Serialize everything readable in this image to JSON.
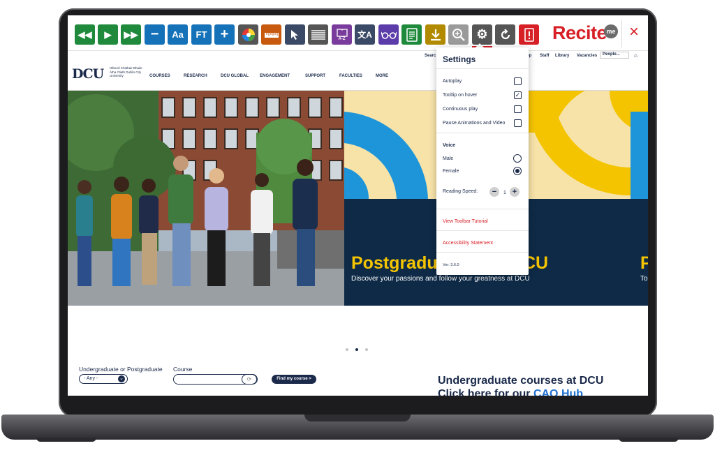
{
  "toolbar": {
    "buttons": [
      {
        "name": "rewind-icon",
        "color": "#1f8a3c",
        "glyph": "◀◀"
      },
      {
        "name": "play-icon",
        "color": "#1f8a3c",
        "glyph": "▶"
      },
      {
        "name": "fast-forward-icon",
        "color": "#1f8a3c",
        "glyph": "▶▶"
      },
      {
        "name": "decrease-text-icon",
        "color": "#1571b8",
        "glyph": "−"
      },
      {
        "name": "text-size-icon",
        "color": "#1571b8",
        "glyph": "Aa"
      },
      {
        "name": "font-type-icon",
        "color": "#1571b8",
        "glyph": "FT"
      },
      {
        "name": "increase-text-icon",
        "color": "#1571b8",
        "glyph": "+"
      },
      {
        "name": "color-wheel-icon",
        "color": "#555555",
        "glyph": ""
      },
      {
        "name": "ruler-icon",
        "color": "#c75a0f",
        "glyph": ""
      },
      {
        "name": "cursor-icon",
        "color": "#3a4a66",
        "glyph": ""
      },
      {
        "name": "reading-mask-icon",
        "color": "#555555",
        "glyph": ""
      },
      {
        "name": "dictionary-icon",
        "color": "#7a3c9c",
        "glyph": "A-Z"
      },
      {
        "name": "translate-icon",
        "color": "#3a4a66",
        "glyph": "文A"
      },
      {
        "name": "glasses-icon",
        "color": "#5b3ca8",
        "glyph": "oo"
      },
      {
        "name": "text-only-icon",
        "color": "#1f8a3c",
        "glyph": ""
      },
      {
        "name": "download-icon",
        "color": "#b28a00",
        "glyph": "⬇"
      },
      {
        "name": "magnifier-icon",
        "color": "#9a9a9a",
        "glyph": "⊕"
      },
      {
        "name": "settings-icon",
        "color": "#555555",
        "glyph": "⚙"
      },
      {
        "name": "reset-icon",
        "color": "#555555",
        "glyph": "⟲"
      },
      {
        "name": "help-icon",
        "color": "#d71f26",
        "glyph": "!"
      }
    ],
    "brand": "Recite",
    "brand_badge": "me",
    "close": "×"
  },
  "utility": {
    "search": "Searc",
    "links": [
      "op",
      "Staff",
      "Library",
      "Vacancies"
    ],
    "people": "People..."
  },
  "logo": {
    "text": "DCU",
    "sub": "Ollscoil Chathair Bhaile Átha Cliath Dublin City University"
  },
  "nav": [
    "COURSES",
    "RESEARCH",
    "DCU GLOBAL",
    "ENGAGEMENT",
    "SUPPORT",
    "FACULTIES",
    "MORE"
  ],
  "hero": {
    "title": "Postgradu",
    "title_end": "CU",
    "subtitle": "Discover your passions and follow your greatness at DCU",
    "next_title": "P",
    "next_sub": "To"
  },
  "finder": {
    "level_label": "Undergraduate or Postgraduate",
    "level_value": "- Any -",
    "course_label": "Course",
    "find_button": "Find my course >"
  },
  "ug": {
    "title": "Undergraduate courses at DCU",
    "link_prefix": "Click here for our",
    "link_text": "CAO Hub"
  },
  "settings": {
    "title": "Settings",
    "autoplay": "Autoplay",
    "tooltip": "Tooltip on hover",
    "tooltip_checked": "✓",
    "continuous": "Continuous play",
    "pause": "Pause Animations and Video",
    "voice_heading": "Voice",
    "male": "Male",
    "female": "Female",
    "speed_label": "Reading Speed:",
    "speed_minus": "−",
    "speed_value": "1",
    "speed_plus": "+",
    "tutorial": "View Toolbar Tutorial",
    "statement": "Accessibility Statement",
    "version": "Ver: 3.6.0"
  }
}
